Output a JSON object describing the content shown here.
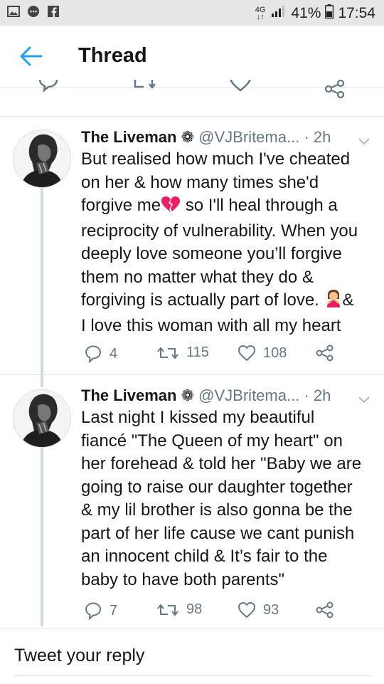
{
  "status_bar": {
    "network": "4G",
    "battery": "41%",
    "time": "17:54"
  },
  "header": {
    "title": "Thread"
  },
  "tweets": [
    {
      "name": "The Liveman",
      "handle": "@VJBritema...",
      "time": "· 2h",
      "text": [
        "But realised how much I've cheated",
        "on her & how many times she'd",
        "forgive me",
        " so I'll heal through a",
        "reciprocity of vulnerability. When you",
        "deeply love someone you’ll forgive",
        "them no matter what they do &",
        "forgiving is actually part of love. ",
        "&",
        "I love this woman with all my heart"
      ],
      "replies": "4",
      "retweets": "115",
      "likes": "108"
    },
    {
      "name": "The Liveman",
      "handle": "@VJBritema...",
      "time": "· 2h",
      "text": [
        "Last night I kissed my beautiful",
        "fiancé \"The Queen of my heart\" on",
        "her forehead & told her \"Baby we are",
        "going to raise our daughter together",
        "& my lil brother is also gonna be the",
        "part of her life cause we cant punish",
        "an innocent child & It’s fair to the",
        "baby to have both parents\""
      ],
      "replies": "7",
      "retweets": "98",
      "likes": "93"
    }
  ],
  "reply_box": {
    "placeholder": "Tweet your reply"
  },
  "colors": {
    "accent": "#1da1f2",
    "muted": "#657786",
    "divider": "#e1e8ed",
    "thread_line": "#cfd9de"
  },
  "icons": [
    "back-arrow-icon",
    "reply-icon",
    "retweet-icon",
    "like-icon",
    "share-icon",
    "chevron-down-icon",
    "flower-icon",
    "broken-heart-icon",
    "person-gesture-icon"
  ]
}
